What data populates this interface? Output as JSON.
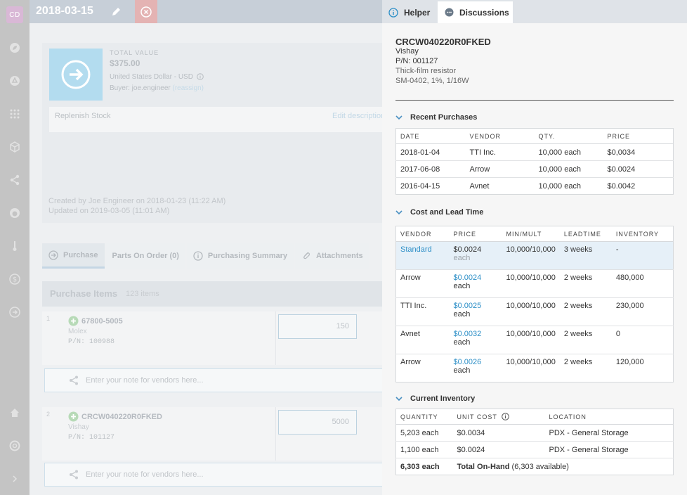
{
  "app": {
    "avatar": "CD",
    "title": "2018-03-15"
  },
  "sidebar": {
    "icons": [
      "leaf-icon",
      "recycle-icon",
      "grid-icon",
      "box-icon",
      "share-icon",
      "gauge-icon",
      "thermometer-icon",
      "dollar-icon",
      "arrow-circle-icon"
    ],
    "footer_icons": [
      "home-icon",
      "help-icon",
      "chevron-right-icon"
    ]
  },
  "summary": {
    "total_label": "TOTAL VALUE",
    "total_amount": "$375.00",
    "currency": "United States Dollar - USD",
    "buyer": "Buyer: joe.engineer",
    "reassign": "(reassign)",
    "description": "Replenish Stock",
    "edit_description": "Edit description",
    "created": "Created by Joe Engineer on 2018-01-23 (11:22 AM)",
    "updated": "Updated on 2019-03-05 (11:01 AM)"
  },
  "tabs": [
    {
      "label": "Purchase"
    },
    {
      "label": "Parts On Order (0)"
    },
    {
      "label": "Purchasing Summary"
    },
    {
      "label": "Attachments"
    }
  ],
  "purchase_items": {
    "title": "Purchase Items",
    "count": "123 items",
    "note_placeholder": "Enter your note for vendors here...",
    "items": [
      {
        "num": "1",
        "pn": "67800-5005",
        "mfr": "Molex",
        "part": "P/N: 100988",
        "qty": "150"
      },
      {
        "num": "2",
        "pn": "CRCW040220R0FKED",
        "mfr": "Vishay",
        "part": "P/N: 101127",
        "qty": "5000"
      }
    ]
  },
  "panel": {
    "tabs": {
      "helper": "Helper",
      "discussions": "Discussions"
    },
    "part": {
      "name": "CRCW040220R0FKED",
      "mfr": "Vishay",
      "pn": "P/N: 001127",
      "type": "Thick-film resistor",
      "spec": "SM-0402, 1%, 1/16W"
    },
    "recent_purchases": {
      "title": "Recent Purchases",
      "headers": [
        "DATE",
        "VENDOR",
        "QTY.",
        "PRICE"
      ],
      "rows": [
        [
          "2018-01-04",
          "TTI Inc.",
          "10,000 each",
          "$0,0034"
        ],
        [
          "2017-06-08",
          "Arrow",
          "10,000 each",
          "$0.0024"
        ],
        [
          "2016-04-15",
          "Avnet",
          "10,000 each",
          "$0.0042"
        ]
      ]
    },
    "cost_lead": {
      "title": "Cost and Lead Time",
      "headers": [
        "VENDOR",
        "PRICE",
        "MIN/MULT",
        "LEADTIME",
        "INVENTORY"
      ],
      "rows": [
        {
          "vendor": "Standard",
          "price": "$0.0024",
          "unit": "each",
          "minmult": "10,000/10,000",
          "lead": "3 weeks",
          "inv": "-"
        },
        {
          "vendor": "Arrow",
          "price": "$0.0024",
          "unit": "each",
          "minmult": "10,000/10,000",
          "lead": "2 weeks",
          "inv": "480,000"
        },
        {
          "vendor": "TTI Inc.",
          "price": "$0.0025",
          "unit": "each",
          "minmult": "10,000/10,000",
          "lead": "2 weeks",
          "inv": "230,000"
        },
        {
          "vendor": "Avnet",
          "price": "$0.0032",
          "unit": "each",
          "minmult": "10,000/10,000",
          "lead": "2 weeks",
          "inv": "0"
        },
        {
          "vendor": "Arrow",
          "price": "$0.0026",
          "unit": "each",
          "minmult": "10,000/10,000",
          "lead": "2 weeks",
          "inv": "120,000"
        }
      ]
    },
    "inventory": {
      "title": "Current Inventory",
      "headers": [
        "QUANTITY",
        "UNIT COST",
        "LOCATION"
      ],
      "rows": [
        [
          "5,203 each",
          "$0.0034",
          "PDX - General Storage"
        ],
        [
          "1,100 each",
          "$0.0024",
          "PDX - General Storage"
        ]
      ],
      "total_qty": "6,303 each",
      "total_label": "Total On-Hand",
      "total_available": "(6,303 available)"
    }
  },
  "colors": {
    "accent": "#2d8fc7",
    "highlight_row": "#e6f0f8",
    "sidebar": "#c4c4c4"
  }
}
